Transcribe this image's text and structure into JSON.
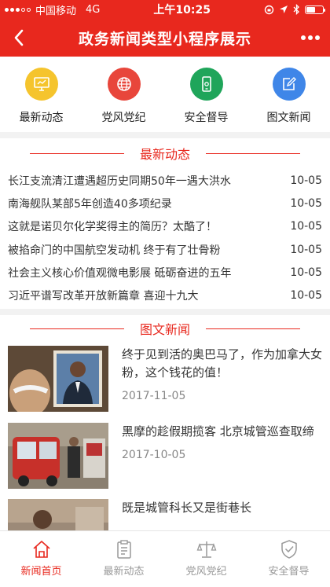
{
  "status_bar": {
    "carrier": "中国移动",
    "network": "4G",
    "time": "上午10:25"
  },
  "nav": {
    "title": "政务新闻类型小程序展示"
  },
  "categories": [
    {
      "label": "最新动态",
      "color": "#f5c42d",
      "icon": "monitor-icon"
    },
    {
      "label": "党风党纪",
      "color": "#e8463b",
      "icon": "globe-icon"
    },
    {
      "label": "安全督导",
      "color": "#1fa55a",
      "icon": "phone-icon"
    },
    {
      "label": "图文新闻",
      "color": "#3f86e8",
      "icon": "edit-icon"
    }
  ],
  "latest": {
    "heading": "最新动态",
    "items": [
      {
        "title": "长江支流清江遭遇超历史同期50年一遇大洪水",
        "date": "10-05"
      },
      {
        "title": "南海舰队某部5年创造40多项纪录",
        "date": "10-05"
      },
      {
        "title": "这就是诺贝尔化学奖得主的简历？太酷了！",
        "date": "10-05"
      },
      {
        "title": "被掐命门的中国航空发动机 终于有了壮骨粉",
        "date": "10-05"
      },
      {
        "title": "社会主义核心价值观微电影展 砥砺奋进的五年",
        "date": "10-05"
      },
      {
        "title": "习近平谱写改革开放新篇章 喜迎十九大",
        "date": "10-05"
      }
    ]
  },
  "picture_news": {
    "heading": "图文新闻",
    "items": [
      {
        "title": "终于见到活的奥巴马了，作为加拿大女粉，这个钱花的值！",
        "date": "2017-11-05"
      },
      {
        "title": "黑摩的趁假期揽客 北京城管巡查取缔",
        "date": "2017-10-05"
      },
      {
        "title": "既是城管科长又是街巷长",
        "date": ""
      }
    ]
  },
  "tabs": [
    {
      "label": "新闻首页",
      "active": true
    },
    {
      "label": "最新动态",
      "active": false
    },
    {
      "label": "党风党纪",
      "active": false
    },
    {
      "label": "安全督导",
      "active": false
    }
  ],
  "colors": {
    "primary": "#e8281e",
    "divider": "#f2f2f2",
    "inactive": "#999999"
  }
}
